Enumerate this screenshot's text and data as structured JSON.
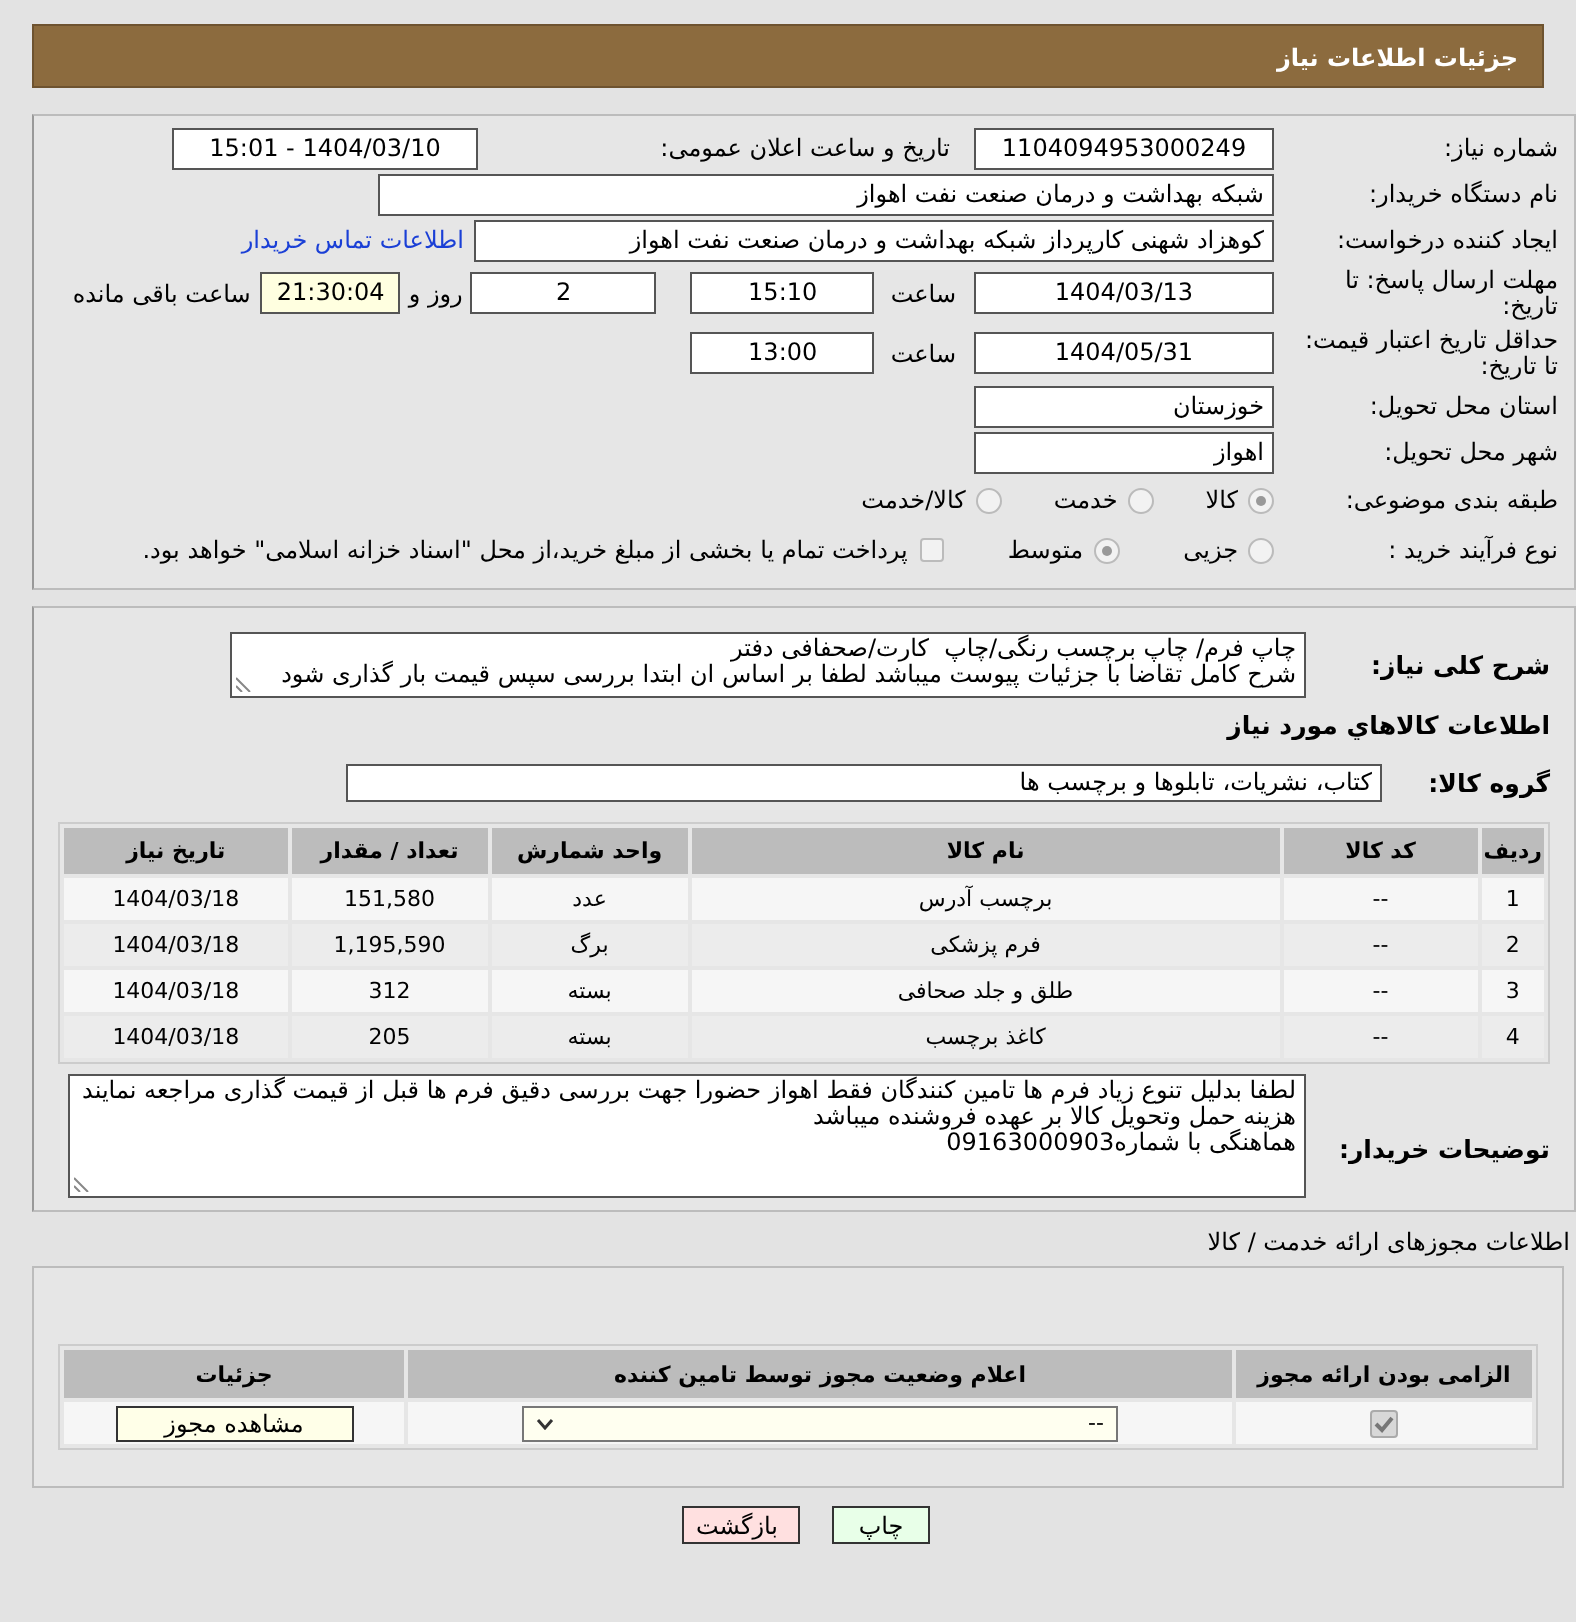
{
  "header": {
    "title": "جزئیات اطلاعات نیاز"
  },
  "need_number": {
    "label": "شماره نیاز:",
    "value": "1104094953000249"
  },
  "announcement": {
    "label": "تاریخ و ساعت اعلان عمومی:",
    "value": "1404/03/10 - 15:01"
  },
  "buyer_org": {
    "label": "نام دستگاه خریدار:",
    "value": "شبکه بهداشت و درمان صنعت نفت اهواز"
  },
  "requester": {
    "label": "ایجاد کننده درخواست:",
    "value": "کوهزاد شهنی کارپرداز شبکه بهداشت و درمان صنعت نفت اهواز",
    "link": "اطلاعات تماس خریدار"
  },
  "reply_deadline": {
    "label": "مهلت ارسال پاسخ: تا تاریخ:",
    "date": "1404/03/13",
    "time_label": "ساعت",
    "time": "15:10",
    "days": "2",
    "days_label": "روز و",
    "remaining": "21:30:04",
    "remaining_label": "ساعت باقی مانده"
  },
  "price_validity": {
    "label": "حداقل تاریخ اعتبار قیمت: تا تاریخ:",
    "date": "1404/05/31",
    "time_label": "ساعت",
    "time": "13:00"
  },
  "province": {
    "label": "استان محل تحویل:",
    "value": "خوزستان"
  },
  "city": {
    "label": "شهر محل تحویل:",
    "value": "اهواز"
  },
  "category": {
    "label": "طبقه بندی موضوعی:",
    "options": [
      {
        "label": "کالا",
        "selected": true
      },
      {
        "label": "خدمت",
        "selected": false
      },
      {
        "label": "کالا/خدمت",
        "selected": false
      }
    ]
  },
  "purchase_process": {
    "label": "نوع فرآیند خرید :",
    "options": [
      {
        "label": "جزیی",
        "selected": false
      },
      {
        "label": "متوسط",
        "selected": true
      }
    ],
    "payment": {
      "label": "پرداخت تمام یا بخشی از مبلغ خرید،از محل \"اسناد خزانه اسلامی\" خواهد بود.",
      "checked": false
    }
  },
  "description": {
    "label": "شرح کلی نیاز:",
    "text": "چاپ فرم/ چاپ برچسب رنگی/چاپ  کارت/صحفافی دفتر\nشرح کامل تقاضا با جزئیات پیوست میباشد لطفا بر اساس ان ابتدا بررسی سپس قیمت بار گذاری شود"
  },
  "goods_heading": "اطلاعات كالاهاي مورد نياز",
  "goods_group": {
    "label": "گروه کالا:",
    "value": "کتاب، نشریات، تابلوها و برچسب ها"
  },
  "goods_table": {
    "columns": [
      "ردیف",
      "کد کالا",
      "نام کالا",
      "واحد شمارش",
      "تعداد / مقدار",
      "تاریخ نیاز"
    ],
    "rows": [
      [
        "1",
        "--",
        "برچسب آدرس",
        "عدد",
        "151,580",
        "1404/03/18"
      ],
      [
        "2",
        "--",
        "فرم پزشکی",
        "برگ",
        "1,195,590",
        "1404/03/18"
      ],
      [
        "3",
        "--",
        "طلق و جلد صحافی",
        "بسته",
        "312",
        "1404/03/18"
      ],
      [
        "4",
        "--",
        "کاغذ برچسب",
        "بسته",
        "205",
        "1404/03/18"
      ]
    ]
  },
  "buyer_notes": {
    "label": "توضیحات خریدار:",
    "text": "لطفا بدلیل تنوع زیاد فرم ها تامین کنندگان فقط اهواز حضورا جهت بررسی دقیق فرم ها قبل از قیمت گذاری مراجعه نمایند\nهزینه حمل وتحویل کالا بر عهده فروشنده میباشد\nهماهنگی با شماره09163000903"
  },
  "licenses_heading": "اطلاعات مجوزهای ارائه خدمت / کالا",
  "license_table": {
    "columns": [
      "الزامی بودن ارائه مجوز",
      "اعلام وضعیت مجوز توسط تامین کننده",
      "جزئیات"
    ],
    "rows": [
      {
        "required": true,
        "status": "--",
        "details_button": "مشاهده مجوز"
      }
    ]
  },
  "buttons": [
    {
      "label": "چاپ",
      "kind": "print"
    },
    {
      "label": "بازگشت",
      "kind": "back"
    }
  ]
}
